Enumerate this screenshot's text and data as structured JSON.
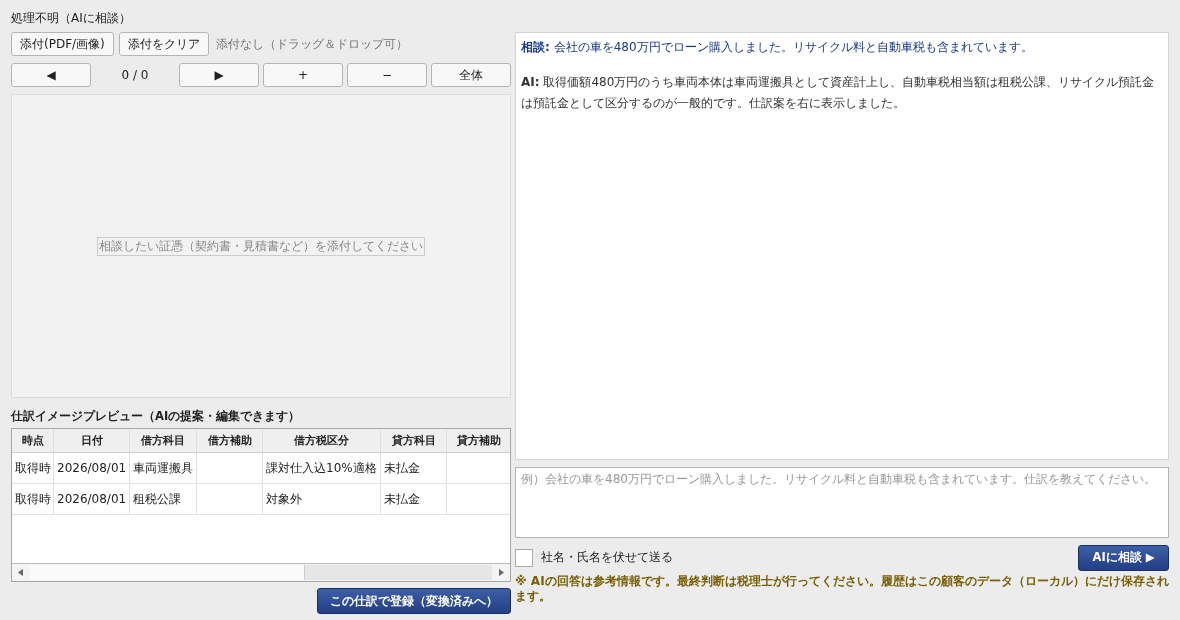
{
  "title": "処理不明（AIに相談）",
  "attach": {
    "buttons": [
      "添付(PDF/画像)",
      "添付をクリア"
    ],
    "status": "添付なし（ドラッグ＆ドロップ可）"
  },
  "nav": {
    "prev": "◀",
    "counter": "0 / 0",
    "next": "▶",
    "zoom_in": "+",
    "zoom_out": "−",
    "fit": "全体"
  },
  "preview": {
    "placeholder": "相談したい証憑（契約書・見積書など）を添付してください"
  },
  "journal": {
    "caption": "仕訳イメージプレビュー（AIの提案・編集できます）",
    "columns": [
      "時点",
      "日付",
      "借方科目",
      "借方補助",
      "借方税区分",
      "貸方科目",
      "貸方補助"
    ],
    "rows": [
      {
        "cells": [
          "取得時",
          "2026/08/01",
          "車両運搬具",
          "",
          "課対仕入込10%適格",
          "未払金",
          ""
        ]
      },
      {
        "cells": [
          "取得時",
          "2026/08/01",
          "租税公課",
          "",
          "対象外",
          "未払金",
          ""
        ]
      }
    ],
    "register_button": "この仕訳で登録（変換済みへ）"
  },
  "chat": {
    "messages": [
      {
        "kind": "user",
        "text": "**相談:** 会社の車を480万円でローン購入しました。リサイクル料と自動車税も含まれています。"
      },
      {
        "kind": "ai",
        "text": "**AI:** 取得価額480万円のうち車両本体は車両運搬具として資産計上し、自動車税相当額は租税公課、リサイクル預託金は預託金として区分するのが一般的です。仕訳案を右に表示しました。"
      }
    ],
    "input": {
      "placeholder": "例）会社の車を480万円でローン購入しました。リサイクル料と自動車税も含まれています。仕訳を教えてください。"
    },
    "mask": {
      "label": "社名・氏名を伏せて送る",
      "checked": false
    },
    "send_button": "AIに相談 ▶",
    "note": "※ AIの回答は参考情報です。最終判断は税理士が行ってください。履歴はこの顧客のデータ（ローカル）にだけ保存されます。"
  }
}
